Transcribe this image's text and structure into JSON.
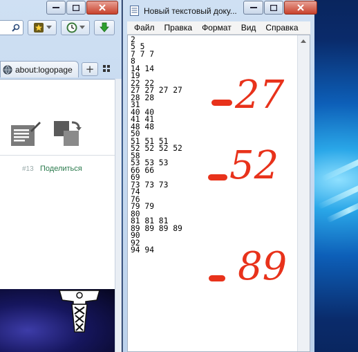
{
  "browser": {
    "tab_label": "about:logopage",
    "new_tab_symbol": "+",
    "share_count": "#13",
    "share_label": "Поделиться"
  },
  "notepad": {
    "title": "Новый текстовый доку...",
    "menu": [
      "Файл",
      "Правка",
      "Формат",
      "Вид",
      "Справка"
    ],
    "lines": [
      "2",
      "5 5",
      "7 7 7",
      "8",
      "14 14",
      "19",
      "22 22",
      "27 27 27 27",
      "28 28",
      "31",
      "40 40",
      "41 41",
      "48 48",
      "50",
      "51 51 51",
      "52 52 52 52",
      "58",
      "53 53 53",
      "66 66",
      "69",
      "73 73 73",
      "74",
      "76",
      "79 79",
      "80",
      "81 81 81",
      "89 89 89 89",
      "90",
      "92",
      "94 94"
    ]
  },
  "annotations": [
    "27",
    "52",
    "89"
  ],
  "colors": {
    "annotation": "#e8321b",
    "share_link": "#2a7a4c",
    "close_button": "#c8422c"
  },
  "icons": [
    "search-icon",
    "bookmark-star-icon",
    "history-clock-icon",
    "download-arrow-icon",
    "globe-icon",
    "edit-note-icon",
    "restore-tabs-icon",
    "thor-hammer-icon",
    "document-icon"
  ]
}
